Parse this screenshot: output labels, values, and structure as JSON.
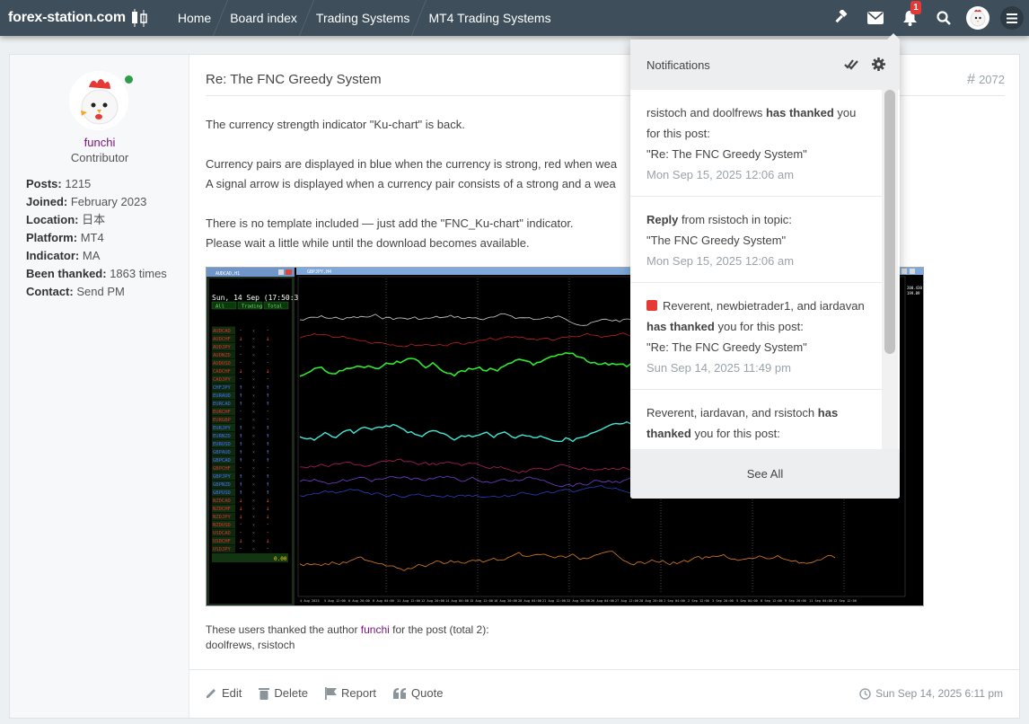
{
  "nav": {
    "brand": "forex-station.com",
    "breadcrumbs": [
      "Home",
      "Board index",
      "Trading Systems",
      "MT4 Trading Systems"
    ],
    "notification_count": "1",
    "icons": [
      "gavel-icon",
      "envelope-icon",
      "bell-icon",
      "search-icon",
      "avatar",
      "menu-icon"
    ]
  },
  "profile": {
    "username": "funchi",
    "rank": "Contributor",
    "fields": [
      {
        "label": "Posts:",
        "value": "1215"
      },
      {
        "label": "Joined:",
        "value": "February 2023"
      },
      {
        "label": "Location:",
        "value": "日本"
      },
      {
        "label": "Platform:",
        "value": "MT4"
      },
      {
        "label": "Indicator:",
        "value": "MA"
      },
      {
        "label": "Been thanked:",
        "value": "1863 times"
      },
      {
        "label": "Contact:",
        "value": "Send PM"
      }
    ]
  },
  "post": {
    "title": "Re: The FNC Greedy System",
    "number": "2072",
    "lines": [
      "The currency strength indicator \"Ku-chart\" is back.",
      "",
      "Currency pairs are displayed in blue when the currency is strong, red when wea",
      "A signal arrow is displayed when a currency pair consists of a strong and a wea",
      "",
      "There is no template included — just add the \"FNC_Ku-chart\" indicator.",
      "Please wait a little while until the download becomes available."
    ],
    "thanks_prefix": "These users thanked the author ",
    "thanks_author": "funchi",
    "thanks_suffix": " for the post (total 2):",
    "thanked_users": "doolfrews, rsistoch",
    "actions": [
      "Edit",
      "Delete",
      "Report",
      "Quote"
    ],
    "timestamp": "Sun Sep 14, 2025 6:11 pm"
  },
  "screenshot": {
    "left_window_title": "AUDCAD,H1",
    "right_window_title": "GBPJPY,H4",
    "panel_date": "Sun, 14 Sep (17:50:3",
    "panel_tabs": [
      "All",
      "Trading",
      "Total"
    ],
    "panel_value": "0.00",
    "pairs": [
      "AUDCAD",
      "AUDCHF",
      "AUDJPY",
      "AUDNZD",
      "AUDUSD",
      "CADCHF",
      "CADJPY",
      "CHFJPY",
      "EURAUD",
      "EURCAD",
      "EURCHF",
      "EURGBP",
      "EURJPY",
      "EURNZD",
      "EURUSD",
      "GBPAUD",
      "GBPCAD",
      "GBPCHF",
      "GBPJPY",
      "GBPNZD",
      "GBPUSD",
      "NZDCAD",
      "NZDCHF",
      "NZDJPY",
      "NZDUSD",
      "USDCAD",
      "USDCHF",
      "USDJPY"
    ],
    "x_ticks": [
      "4 Aug 2025",
      "5 Aug 12:00",
      "6 Aug 20:00",
      "8 Aug 04:00",
      "11 Aug 12:00",
      "12 Aug 20:00",
      "14 Aug 04:00",
      "15 Aug 12:00",
      "18 Aug 20:00",
      "20 Aug 04:00",
      "21 Aug 12:00",
      "22 Aug 20:00",
      "26 Aug 04:00",
      "27 Aug 12:00",
      "28 Aug 20:00",
      "1 Sep 04:00",
      "2 Sep 12:00",
      "3 Sep 20:00",
      "5 Sep 04:00",
      "8 Sep 12:00",
      "9 Sep 20:00",
      "11 Sep 04:00",
      "12 Sep 12:00"
    ],
    "price_labels": [
      "200.430",
      "199.89"
    ]
  },
  "notifications": {
    "header": "Notifications",
    "items": [
      {
        "pre": "rsistoch and doolfrews ",
        "bold": "has thanked",
        "post": " you for this post:",
        "quote": "\"Re: The FNC Greedy System\"",
        "time": "Mon Sep 15, 2025 12:06 am"
      },
      {
        "pre_bold": "Reply",
        "pre": " from rsistoch in topic:",
        "quote": "\"The FNC Greedy System\"",
        "time": "Mon Sep 15, 2025 12:06 am"
      },
      {
        "pre": "Reverent, newbietrader1, and iardavan ",
        "bold": "has thanked",
        "post": " you for this post:",
        "quote": "\"Re: The FNC Greedy System\"",
        "time": "Sun Sep 14, 2025 11:49 pm"
      },
      {
        "pre": "Reverent, iardavan, and rsistoch ",
        "bold": "has thanked",
        "post": " you for this post:"
      }
    ],
    "footer": "See All"
  },
  "colors": {
    "topbar": "#3e4e5a",
    "username": "#7a1580",
    "badge": "#e53935"
  }
}
